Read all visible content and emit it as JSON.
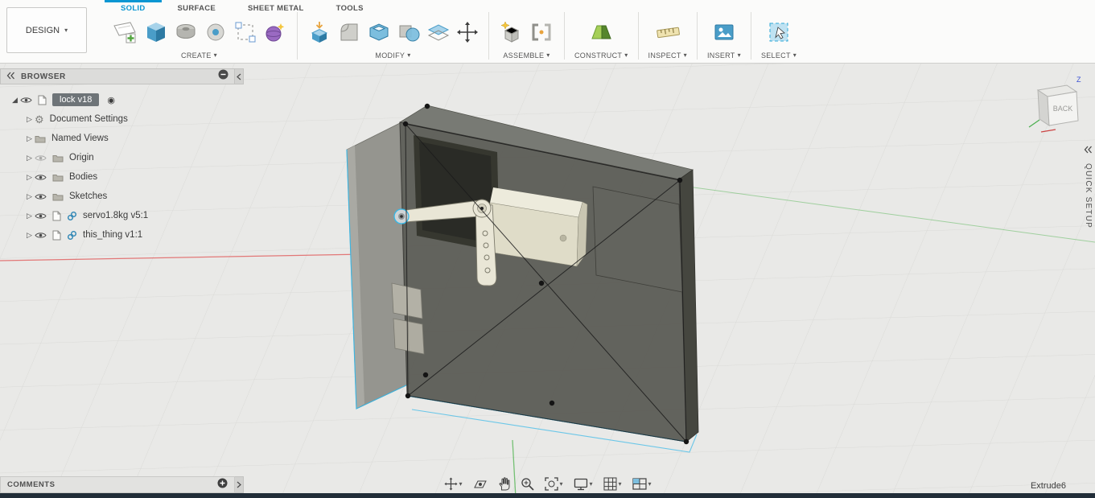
{
  "menu": {
    "design_label": "DESIGN"
  },
  "tabs": [
    {
      "label": "SOLID",
      "active": true
    },
    {
      "label": "SURFACE",
      "active": false
    },
    {
      "label": "SHEET METAL",
      "active": false
    },
    {
      "label": "TOOLS",
      "active": false
    }
  ],
  "ribbon": {
    "groups": [
      {
        "label": "CREATE"
      },
      {
        "label": "MODIFY"
      },
      {
        "label": "ASSEMBLE"
      },
      {
        "label": "CONSTRUCT"
      },
      {
        "label": "INSPECT"
      },
      {
        "label": "INSERT"
      },
      {
        "label": "SELECT"
      }
    ]
  },
  "browser": {
    "title": "BROWSER",
    "root_label": "lock v18",
    "items": [
      {
        "label": "Document Settings",
        "icon": "gear-icon",
        "eye": "none"
      },
      {
        "label": "Named Views",
        "icon": "folder-icon",
        "eye": "none"
      },
      {
        "label": "Origin",
        "icon": "folder-icon",
        "eye": "hidden"
      },
      {
        "label": "Bodies",
        "icon": "folder-icon",
        "eye": "visible"
      },
      {
        "label": "Sketches",
        "icon": "folder-icon",
        "eye": "visible"
      },
      {
        "label": "servo1.8kg v5:1",
        "icon": "component-icon",
        "eye": "visible",
        "linked": true
      },
      {
        "label": "this_thing v1:1",
        "icon": "component-icon",
        "eye": "visible",
        "linked": true
      }
    ]
  },
  "viewcube": {
    "face": "BACK",
    "axis": "Z"
  },
  "side_panel": {
    "label": "QUICK SETUP"
  },
  "comments": {
    "title": "COMMENTS"
  },
  "status": {
    "feature": "Extrude6"
  },
  "glyphs": {
    "caret_down": "▾",
    "tree_expanded": "◢",
    "tree_collapsed": "▷",
    "gear": "⚙",
    "radio_active": "◉"
  },
  "colors": {
    "accent_blue": "#0a96d2",
    "selection_cyan": "#35b8e8",
    "axis_red": "#e05252",
    "axis_green": "#58b757",
    "canvas_bg": "#e9e9e7"
  }
}
